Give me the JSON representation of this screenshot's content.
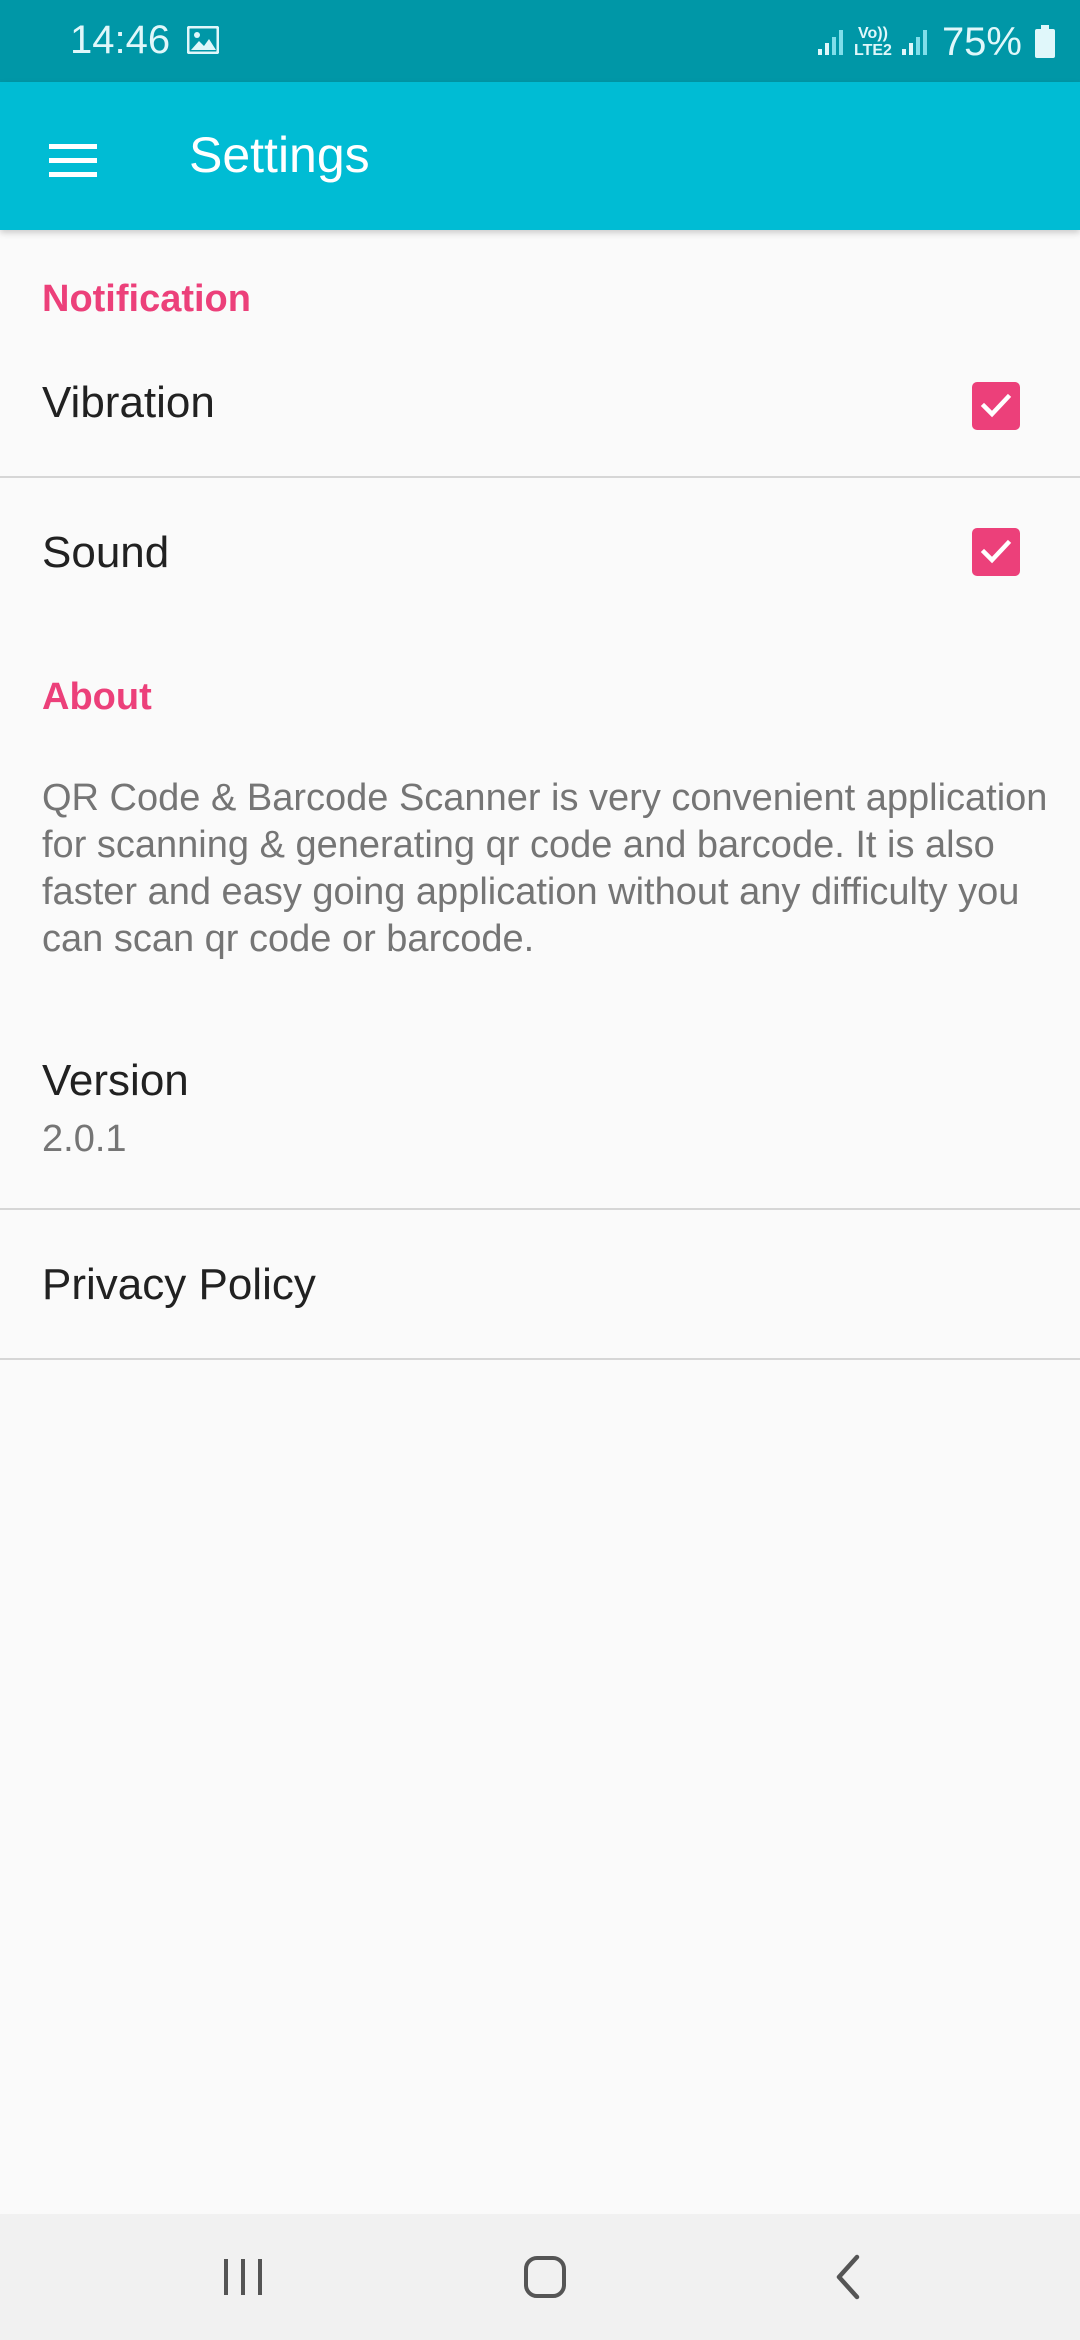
{
  "status_bar": {
    "time": "14:46",
    "network_top": "Vo))",
    "network_bottom": "LTE2",
    "battery": "75%"
  },
  "app_bar": {
    "title": "Settings",
    "menu_icon": "hamburger-menu-icon"
  },
  "notification": {
    "header": "Notification",
    "vibration": {
      "label": "Vibration",
      "checked": true
    },
    "sound": {
      "label": "Sound",
      "checked": true
    }
  },
  "about": {
    "header": "About",
    "description": "QR Code & Barcode Scanner is very convenient application for scanning & generating qr code and barcode. It is also faster and easy going application without any difficulty you can scan qr code or barcode.",
    "version_label": "Version",
    "version_value": "2.0.1",
    "privacy_label": "Privacy Policy"
  },
  "nav_bar": {
    "recents_icon": "recents-icon",
    "home_icon": "home-icon",
    "back_icon": "back-icon"
  },
  "colors": {
    "status_bar": "#0097a7",
    "app_bar": "#00bcd4",
    "accent": "#ec407a",
    "background": "#fafafa"
  }
}
